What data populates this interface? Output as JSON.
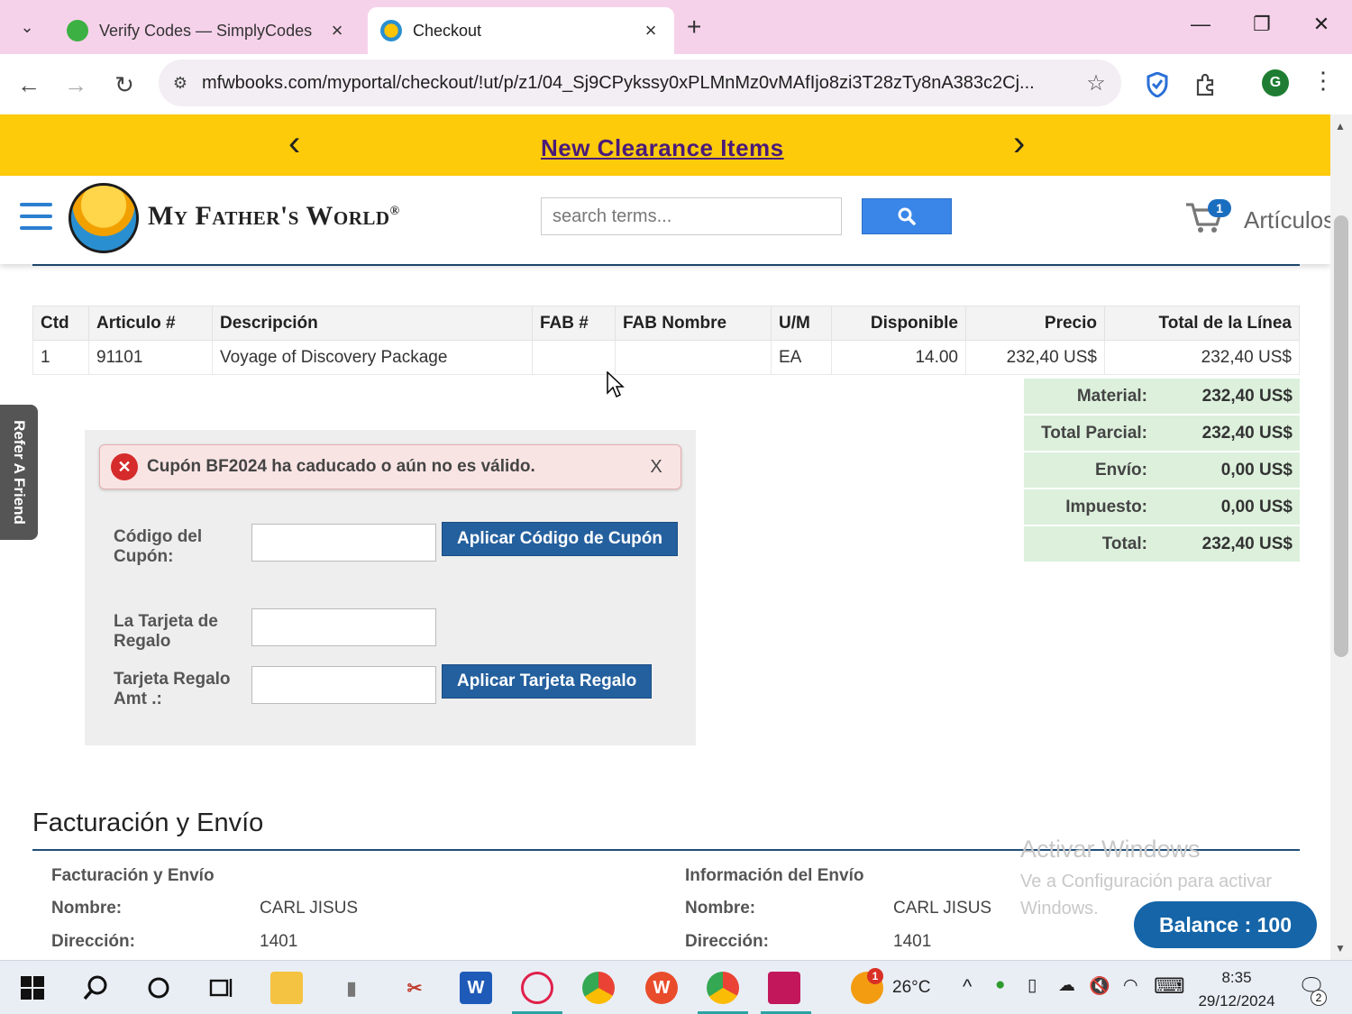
{
  "browser": {
    "tabs": [
      {
        "title": "Verify Codes — SimplyCodes",
        "active": false
      },
      {
        "title": "Checkout",
        "active": true
      }
    ],
    "url": "mfwbooks.com/myportal/checkout/!ut/p/z1/04_Sj9CPykssy0xPLMnMz0vMAfIjo8zi3T28zTy8nA383c2Cj..."
  },
  "promo": {
    "link": "New Clearance Items"
  },
  "header": {
    "logo_text": "My Father's World",
    "logo_mark": "®",
    "search_placeholder": "search terms...",
    "cart_count": "1",
    "cart_label": "Artículos"
  },
  "items_table": {
    "headers": [
      "Ctd",
      "Articulo #",
      "Descripción",
      "FAB #",
      "FAB Nombre",
      "U/M",
      "Disponible",
      "Precio",
      "Total de la Línea"
    ],
    "rows": [
      {
        "ctd": "1",
        "articulo": "91101",
        "descripcion": "Voyage of Discovery Package",
        "fab": "",
        "fab_nombre": "",
        "um": "EA",
        "disponible": "14.00",
        "precio": "232,40 US$",
        "total": "232,40 US$"
      }
    ]
  },
  "totals": [
    {
      "label": "Material:",
      "value": "232,40 US$"
    },
    {
      "label": "Total Parcial:",
      "value": "232,40 US$"
    },
    {
      "label": "Envío:",
      "value": "0,00 US$"
    },
    {
      "label": "Impuesto:",
      "value": "0,00 US$"
    },
    {
      "label": "Total:",
      "value": "232,40 US$"
    }
  ],
  "coupon": {
    "alert_message": "Cupón BF2024 ha caducado o aún no es válido.",
    "alert_close": "X",
    "coupon_label": "Código del Cupón:",
    "coupon_value": "",
    "apply_coupon_button": "Aplicar Código de Cupón",
    "gift_card_label": "La Tarjeta de Regalo",
    "gift_card_value": "",
    "gift_amt_label": "Tarjeta Regalo Amt .:",
    "gift_amt_value": "",
    "apply_gift_button": "Aplicar Tarjeta Regalo"
  },
  "refer_tab": "Refer A Friend",
  "billing": {
    "section_title": "Facturación y Envío",
    "billing_head": "Facturación y Envío",
    "shipping_head": "Información del Envío",
    "name_label": "Nombre:",
    "address_label": "Dirección:",
    "billing_name": "CARL JISUS",
    "billing_address": "1401",
    "shipping_name": "CARL JISUS",
    "shipping_address": "1401"
  },
  "watermark": {
    "title": "Activar Windows",
    "subtitle": "Ve a Configuración para activar Windows."
  },
  "balance_badge": "Balance : 100",
  "taskbar": {
    "weather_temp": "26°C",
    "weather_badge": "1",
    "time": "8:35",
    "date": "29/12/2024",
    "notif_count": "2"
  },
  "colors": {
    "promo_bg": "#fecb0b",
    "button_blue": "#24609e",
    "totals_bg": "#dcf0dc",
    "balance_bg": "#1565a8",
    "tab_strip": "#f6d2ea"
  }
}
